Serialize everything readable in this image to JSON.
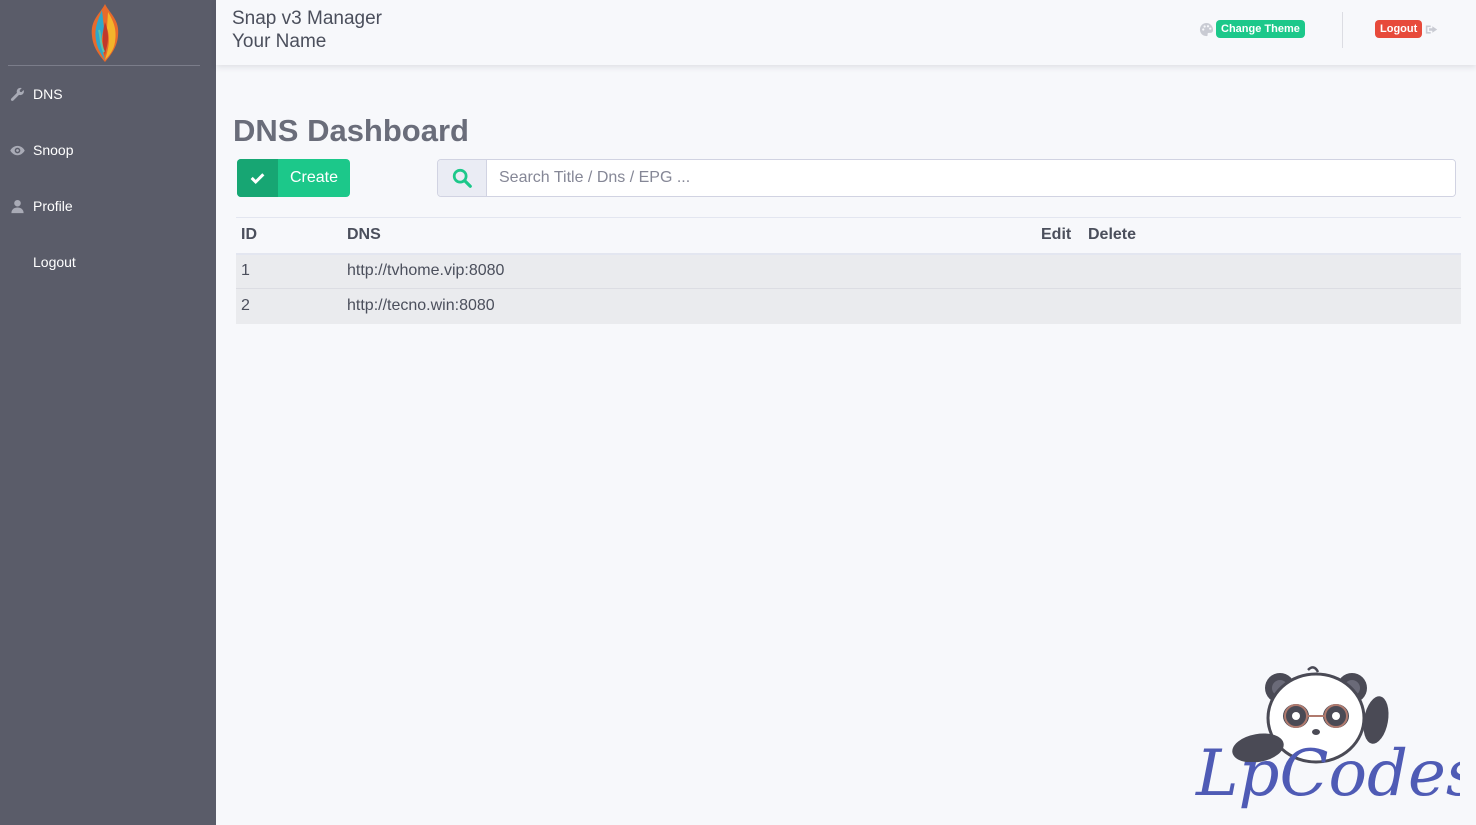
{
  "sidebar": {
    "logo": "flame-logo",
    "items": [
      {
        "label": "DNS",
        "icon": "wrench-icon"
      },
      {
        "label": "Snoop",
        "icon": "eye-icon"
      },
      {
        "label": "Profile",
        "icon": "user-icon"
      },
      {
        "label": "Logout",
        "icon": ""
      }
    ]
  },
  "header": {
    "title": "Snap v3 Manager",
    "user_name": "Your Name",
    "theme_button": "Change Theme",
    "logout_button": "Logout"
  },
  "main": {
    "page_title": "DNS Dashboard",
    "create_label": "Create",
    "search": {
      "placeholder": "Search Title / Dns / EPG ...",
      "value": ""
    },
    "table": {
      "columns": [
        "ID",
        "DNS",
        "Edit",
        "Delete"
      ],
      "rows": [
        {
          "id": "1",
          "dns": "http://tvhome.vip:8080"
        },
        {
          "id": "2",
          "dns": "http://tecno.win:8080"
        }
      ]
    }
  },
  "watermark": {
    "text": "LpCodes"
  },
  "colors": {
    "sidebar": "#5a5c69",
    "success": "#1cc88a",
    "danger": "#e74a3b",
    "background": "#f7f8fb"
  }
}
